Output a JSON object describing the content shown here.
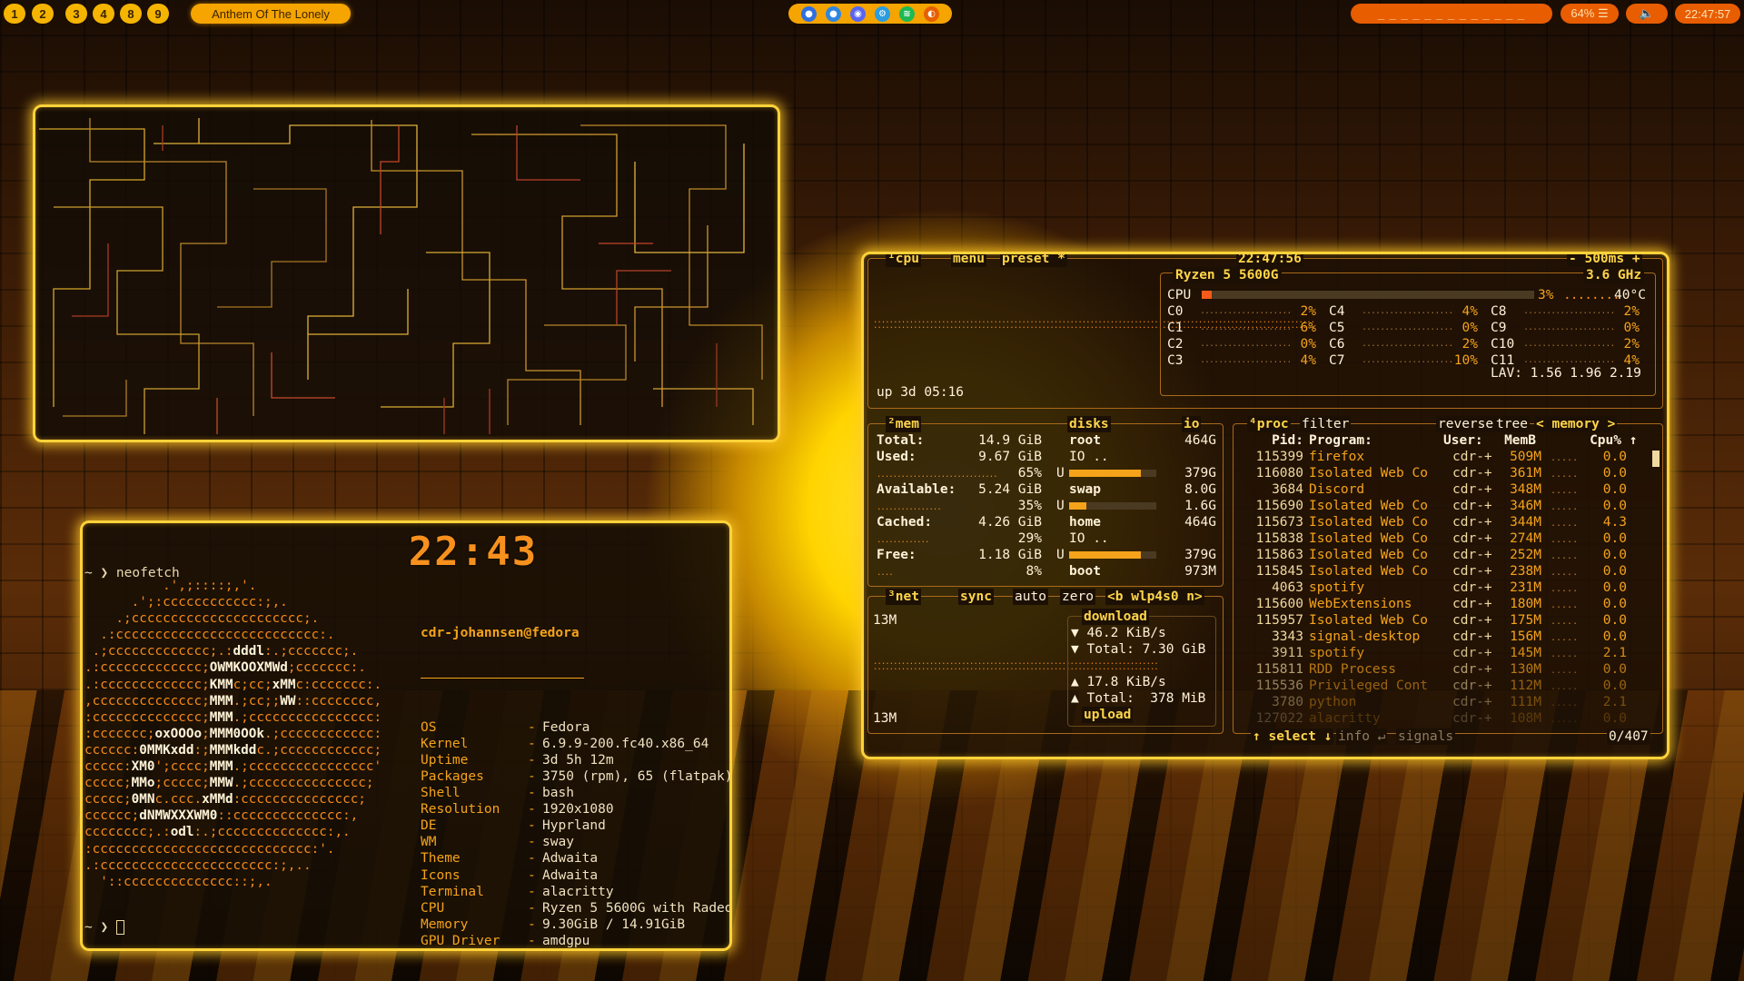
{
  "topbar": {
    "workspaces": [
      "1",
      "2",
      "3",
      "4",
      "8",
      "9"
    ],
    "media_title": "Anthem Of The Lonely",
    "tray_icons": [
      "chromium-icon",
      "chromium-icon",
      "discord-icon",
      "settings-icon",
      "spotify-icon",
      "firefox-icon"
    ],
    "indicator": "_ _ _ _ _ _ _ _ _ _ _ _ _",
    "battery": "64% ☰",
    "volume_icon": "speaker-icon",
    "clock": "22:47:57"
  },
  "terminal": {
    "clock": "22:43",
    "prompt_cmd": "~ ❯ neofetch",
    "prompt_end": "~ ❯ ",
    "ascii": [
      "          .',;::::;,'.",
      "      .';:cccccccccccc:;,.",
      "    .;cccccccccccccccccccccc;.",
      "  .:cccccccccccccccccccccccccc:.",
      " .;ccccccccccccc;.:dddl:.;ccccccc;.",
      ".:ccccccccccccc;OWMKOOXMWd;ccccccc:.",
      ".:ccccccccccccc;KMMc;cc;xMMc:ccccccc:.",
      ",cccccccccccccc;MMM.;cc;;WW::cccccccc,",
      ":cccccccccccccc;MMM.;cccccccccccccccc:",
      ":ccccccc;oxOOOo;MMM0OOk.;cccccccccccc:",
      "cccccc:0MMKxdd:;MMMkddc.;cccccccccccc;",
      "ccccc:XM0';cccc;MMM.;cccccccccccccccc'",
      "ccccc;MMo;ccccc;MMW.;ccccccccccccccc;",
      "ccccc;0MNc.ccc.xMMd:ccccccccccccccc;",
      "cccccc;dNMWXXXWM0::cccccccccccccc:,",
      "cccccccc;.:odl:.;cccccccccccccc:,.",
      ":cccccccccccccccccccccccccccc:'.",
      ".:cccccccccccccccccccccc:;,..",
      "  '::cccccccccccccc::;,."
    ],
    "user_host": "cdr-johannsen@fedora",
    "info": [
      {
        "k": "OS",
        "v": "Fedora"
      },
      {
        "k": "Kernel",
        "v": "6.9.9-200.fc40.x86_64"
      },
      {
        "k": "Uptime",
        "v": "3d 5h 12m"
      },
      {
        "k": "Packages",
        "v": "3750 (rpm), 65 (flatpak)"
      },
      {
        "k": "Shell",
        "v": "bash"
      },
      {
        "k": "Resolution",
        "v": "1920x1080"
      },
      {
        "k": "DE",
        "v": "Hyprland"
      },
      {
        "k": "WM",
        "v": "sway"
      },
      {
        "k": "Theme",
        "v": "Adwaita"
      },
      {
        "k": "Icons",
        "v": "Adwaita"
      },
      {
        "k": "Terminal",
        "v": "alacritty"
      },
      {
        "k": "CPU",
        "v": "Ryzen 5 5600G with Radeo"
      },
      {
        "k": "Memory",
        "v": "9.30GiB / 14.91GiB"
      },
      {
        "k": "GPU Driver",
        "v": "amdgpu"
      }
    ],
    "separator": "-"
  },
  "btop": {
    "cpu_tab": "¹cpu",
    "menu": "menu",
    "preset": "preset *",
    "time": "22:47:56",
    "interval": "- 500ms +",
    "cpu_model": "Ryzen 5 5600G",
    "freq": "3.6 GHz",
    "cpu_total_label": "CPU",
    "cpu_total_pct": "3%",
    "cpu_temp": "40°C",
    "cores": [
      {
        "n": "C0",
        "p": "2%"
      },
      {
        "n": "C1",
        "p": "6%"
      },
      {
        "n": "C2",
        "p": "0%"
      },
      {
        "n": "C3",
        "p": "4%"
      },
      {
        "n": "C4",
        "p": "4%"
      },
      {
        "n": "C5",
        "p": "0%"
      },
      {
        "n": "C6",
        "p": "2%"
      },
      {
        "n": "C7",
        "p": "10%"
      },
      {
        "n": "C8",
        "p": "2%"
      },
      {
        "n": "C9",
        "p": "0%"
      },
      {
        "n": "C10",
        "p": "2%"
      },
      {
        "n": "C11",
        "p": "4%"
      }
    ],
    "uptime": "up 3d 05:16",
    "lav": "LAV: 1.56 1.96 2.19",
    "mem_tab": "²mem",
    "disks_tab": "disks",
    "io_tab": "io",
    "mem": [
      {
        "k": "Total:",
        "v": "14.9 GiB"
      },
      {
        "k": "Used:",
        "v": "9.67 GiB",
        "pct": "65%",
        "frac": 0.65
      },
      {
        "k": "Available:",
        "v": "5.24 GiB",
        "pct": "35%",
        "frac": 0.35
      },
      {
        "k": "Cached:",
        "v": "4.26 GiB",
        "pct": "29%",
        "frac": 0.29
      },
      {
        "k": "Free:",
        "v": "1.18 GiB",
        "pct": "8%",
        "frac": 0.08
      }
    ],
    "disks": [
      {
        "name": "root",
        "size": "464G",
        "io": "IO",
        "used": "379G",
        "frac": 0.82
      },
      {
        "name": "swap",
        "size": "8.0G",
        "used": "1.6G",
        "frac": 0.2
      },
      {
        "name": "home",
        "size": "464G",
        "io": "IO",
        "used": "379G",
        "frac": 0.82
      },
      {
        "name": "boot",
        "size": "973M"
      }
    ],
    "disk_used_label": "U",
    "net_tab": "³net",
    "net_sync": "sync",
    "net_auto": "auto",
    "net_zero": "zero",
    "net_iface": "<b wlp4s0 n>",
    "net_top": "13M",
    "net_bottom": "13M",
    "download": "download",
    "dl_rate": "▼ 46.2 KiB/s",
    "dl_total": "▼ Total: 7.30 GiB",
    "ul_rate": "▲ 17.8 KiB/s",
    "ul_total": "▲ Total:  378 MiB",
    "upload": "upload",
    "proc_tab": "⁴proc",
    "filter": "filter",
    "reverse": "reverse",
    "tree": "tree",
    "sort": "< memory >",
    "proc_headers": {
      "pid": "Pid:",
      "prog": "Program:",
      "user": "User:",
      "mem": "MemB",
      "cpu": "Cpu%"
    },
    "procs": [
      {
        "pid": "115399",
        "prog": "firefox",
        "user": "cdr-+",
        "mem": "509M",
        "cpu": "0.0"
      },
      {
        "pid": "116080",
        "prog": "Isolated Web Co",
        "user": "cdr-+",
        "mem": "361M",
        "cpu": "0.0"
      },
      {
        "pid": "3684",
        "prog": "Discord",
        "user": "cdr-+",
        "mem": "348M",
        "cpu": "0.0"
      },
      {
        "pid": "115690",
        "prog": "Isolated Web Co",
        "user": "cdr-+",
        "mem": "346M",
        "cpu": "0.0"
      },
      {
        "pid": "115673",
        "prog": "Isolated Web Co",
        "user": "cdr-+",
        "mem": "344M",
        "cpu": "4.3"
      },
      {
        "pid": "115838",
        "prog": "Isolated Web Co",
        "user": "cdr-+",
        "mem": "274M",
        "cpu": "0.0"
      },
      {
        "pid": "115863",
        "prog": "Isolated Web Co",
        "user": "cdr-+",
        "mem": "252M",
        "cpu": "0.0"
      },
      {
        "pid": "115845",
        "prog": "Isolated Web Co",
        "user": "cdr-+",
        "mem": "238M",
        "cpu": "0.0"
      },
      {
        "pid": "4063",
        "prog": "spotify",
        "user": "cdr-+",
        "mem": "231M",
        "cpu": "0.0"
      },
      {
        "pid": "115600",
        "prog": "WebExtensions",
        "user": "cdr-+",
        "mem": "180M",
        "cpu": "0.0"
      },
      {
        "pid": "115957",
        "prog": "Isolated Web Co",
        "user": "cdr-+",
        "mem": "175M",
        "cpu": "0.0"
      },
      {
        "pid": "3343",
        "prog": "signal-desktop",
        "user": "cdr-+",
        "mem": "156M",
        "cpu": "0.0"
      },
      {
        "pid": "3911",
        "prog": "spotify",
        "user": "cdr-+",
        "mem": "145M",
        "cpu": "2.1"
      },
      {
        "pid": "115811",
        "prog": "RDD Process",
        "user": "cdr-+",
        "mem": "130M",
        "cpu": "0.0"
      },
      {
        "pid": "115536",
        "prog": "Privileged Cont",
        "user": "cdr-+",
        "mem": "112M",
        "cpu": "0.0"
      },
      {
        "pid": "3780",
        "prog": "python",
        "user": "cdr-+",
        "mem": "111M",
        "cpu": "2.1"
      },
      {
        "pid": "127022",
        "prog": "alacritty",
        "user": "cdr-+",
        "mem": "108M",
        "cpu": "0.0"
      }
    ],
    "select": "↑ select ↓",
    "info": "info ↵",
    "signals": "signals",
    "count": "0/407"
  }
}
